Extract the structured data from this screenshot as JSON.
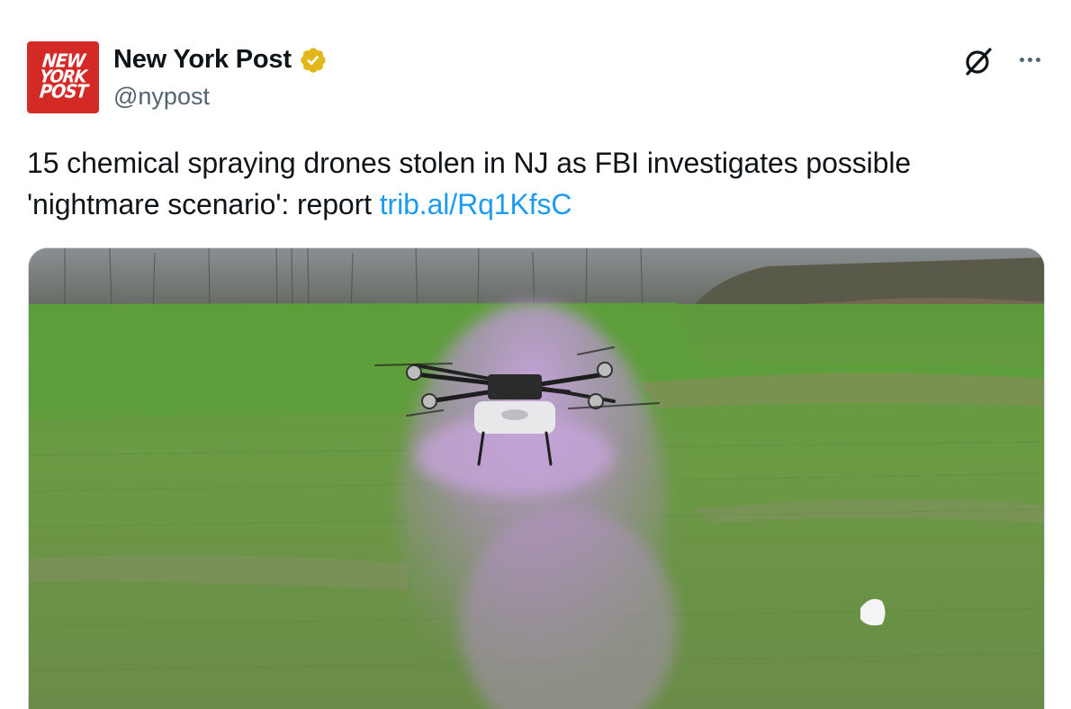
{
  "author": {
    "display_name": "New York Post",
    "handle": "@nypost",
    "avatar_text": [
      "NEW",
      "YORK",
      "POST"
    ],
    "verified_badge_color": "#e2b719",
    "avatar_color": "#d42a26"
  },
  "tweet": {
    "text": "15 chemical spraying drones stolen in NJ as FBI investigates possible 'nightmare scenario': report ",
    "link_text": "trib.al/Rq1KfsC",
    "link_color": "#1d9bf0"
  },
  "actions": {
    "grok_icon": "grok-icon",
    "more_icon": "more-horizontal-icon"
  },
  "media": {
    "description_icon": "photo"
  }
}
